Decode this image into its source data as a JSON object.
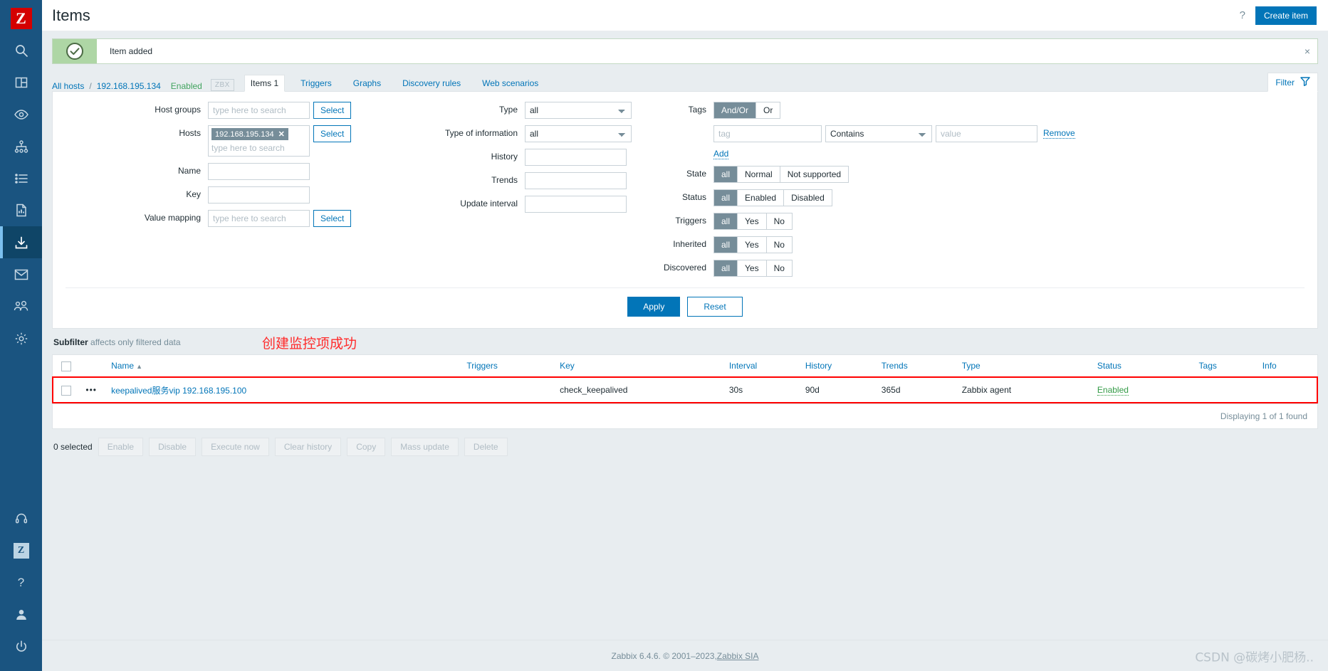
{
  "sidebar": {
    "logo_letter": "Z",
    "items": [
      {
        "name": "search-icon",
        "label": "Search"
      },
      {
        "name": "dashboard-icon",
        "label": "Dashboards"
      },
      {
        "name": "eye-icon",
        "label": "Monitoring"
      },
      {
        "name": "services-tree-icon",
        "label": "Services"
      },
      {
        "name": "list-icon",
        "label": "Inventory"
      },
      {
        "name": "report-icon",
        "label": "Reports"
      },
      {
        "name": "download-icon",
        "label": "Data collection"
      },
      {
        "name": "mail-icon",
        "label": "Alerts"
      },
      {
        "name": "users-icon",
        "label": "Users"
      },
      {
        "name": "gear-icon",
        "label": "Administration"
      }
    ],
    "bottom_items": [
      {
        "name": "support-icon",
        "label": "Support"
      },
      {
        "name": "zabbix-badge-icon",
        "label": "Z"
      },
      {
        "name": "help-icon",
        "label": "?"
      },
      {
        "name": "user-icon",
        "label": "User settings"
      },
      {
        "name": "power-icon",
        "label": "Sign out"
      }
    ],
    "active_index": 6
  },
  "header": {
    "title": "Items",
    "help_label": "?",
    "create_button": "Create item"
  },
  "message": {
    "text": "Item added",
    "close_label": "×"
  },
  "breadcrumb": {
    "all_hosts": "All hosts",
    "separator": "/",
    "host": "192.168.195.134",
    "status": "Enabled",
    "interface_badge": "ZBX",
    "tabs": [
      {
        "label": "Items 1",
        "selected": true
      },
      {
        "label": "Triggers",
        "selected": false
      },
      {
        "label": "Graphs",
        "selected": false
      },
      {
        "label": "Discovery rules",
        "selected": false
      },
      {
        "label": "Web scenarios",
        "selected": false
      }
    ],
    "filter_tab": "Filter"
  },
  "filter": {
    "host_groups": {
      "label": "Host groups",
      "placeholder": "type here to search",
      "value": "",
      "select_button": "Select"
    },
    "hosts": {
      "label": "Hosts",
      "chip": "192.168.195.134",
      "chip_remove": "✕",
      "placeholder": "type here to search",
      "select_button": "Select"
    },
    "name": {
      "label": "Name",
      "value": ""
    },
    "key": {
      "label": "Key",
      "value": ""
    },
    "value_mapping": {
      "label": "Value mapping",
      "placeholder": "type here to search",
      "value": "",
      "select_button": "Select"
    },
    "type": {
      "label": "Type",
      "value": "all"
    },
    "type_of_information": {
      "label": "Type of information",
      "value": "all"
    },
    "history": {
      "label": "History",
      "value": ""
    },
    "trends": {
      "label": "Trends",
      "value": ""
    },
    "update_interval": {
      "label": "Update interval",
      "value": ""
    },
    "tags": {
      "label": "Tags",
      "operator_options": [
        "And/Or",
        "Or"
      ],
      "operator_selected": "And/Or",
      "tag_placeholder": "tag",
      "condition_value": "Contains",
      "value_placeholder": "value",
      "remove_label": "Remove",
      "add_label": "Add"
    },
    "state": {
      "label": "State",
      "options": [
        "all",
        "Normal",
        "Not supported"
      ],
      "selected": "all"
    },
    "status": {
      "label": "Status",
      "options": [
        "all",
        "Enabled",
        "Disabled"
      ],
      "selected": "all"
    },
    "triggers": {
      "label": "Triggers",
      "options": [
        "all",
        "Yes",
        "No"
      ],
      "selected": "all"
    },
    "inherited": {
      "label": "Inherited",
      "options": [
        "all",
        "Yes",
        "No"
      ],
      "selected": "all"
    },
    "discovered": {
      "label": "Discovered",
      "options": [
        "all",
        "Yes",
        "No"
      ],
      "selected": "all"
    },
    "apply_button": "Apply",
    "reset_button": "Reset"
  },
  "subfilter": {
    "title": "Subfilter",
    "note": "affects only filtered data"
  },
  "annotation": {
    "text": "创建监控项成功",
    "color": "#ff2b2b"
  },
  "table": {
    "columns": [
      {
        "key": "checkbox",
        "label": ""
      },
      {
        "key": "dots",
        "label": ""
      },
      {
        "key": "name",
        "label": "Name",
        "sorted": true,
        "sort_arrow": "▲"
      },
      {
        "key": "triggers",
        "label": "Triggers"
      },
      {
        "key": "key",
        "label": "Key"
      },
      {
        "key": "interval",
        "label": "Interval"
      },
      {
        "key": "history",
        "label": "History"
      },
      {
        "key": "trends",
        "label": "Trends"
      },
      {
        "key": "type",
        "label": "Type"
      },
      {
        "key": "status",
        "label": "Status"
      },
      {
        "key": "tags",
        "label": "Tags"
      },
      {
        "key": "info",
        "label": "Info"
      }
    ],
    "rows": [
      {
        "dots": "•••",
        "name": "keepalived服务vip 192.168.195.100",
        "triggers": "",
        "key": "check_keepalived",
        "interval": "30s",
        "history": "90d",
        "trends": "365d",
        "type": "Zabbix agent",
        "status": "Enabled",
        "tags": "",
        "info": "",
        "highlighted": true
      }
    ],
    "footer_text": "Displaying 1 of 1 found"
  },
  "bulk": {
    "selected_text": "0 selected",
    "buttons": [
      "Enable",
      "Disable",
      "Execute now",
      "Clear history",
      "Copy",
      "Mass update",
      "Delete"
    ]
  },
  "footer": {
    "text_before": "Zabbix 6.4.6. © 2001–2023, ",
    "link": "Zabbix SIA",
    "watermark": "CSDN @碳烤小肥杨.."
  },
  "colors": {
    "sidebar": "#1a5480",
    "accent": "#0275b8",
    "logo_red": "#d40000",
    "success_green": "#aed6a5",
    "annotation_red": "#ff2b2b"
  }
}
